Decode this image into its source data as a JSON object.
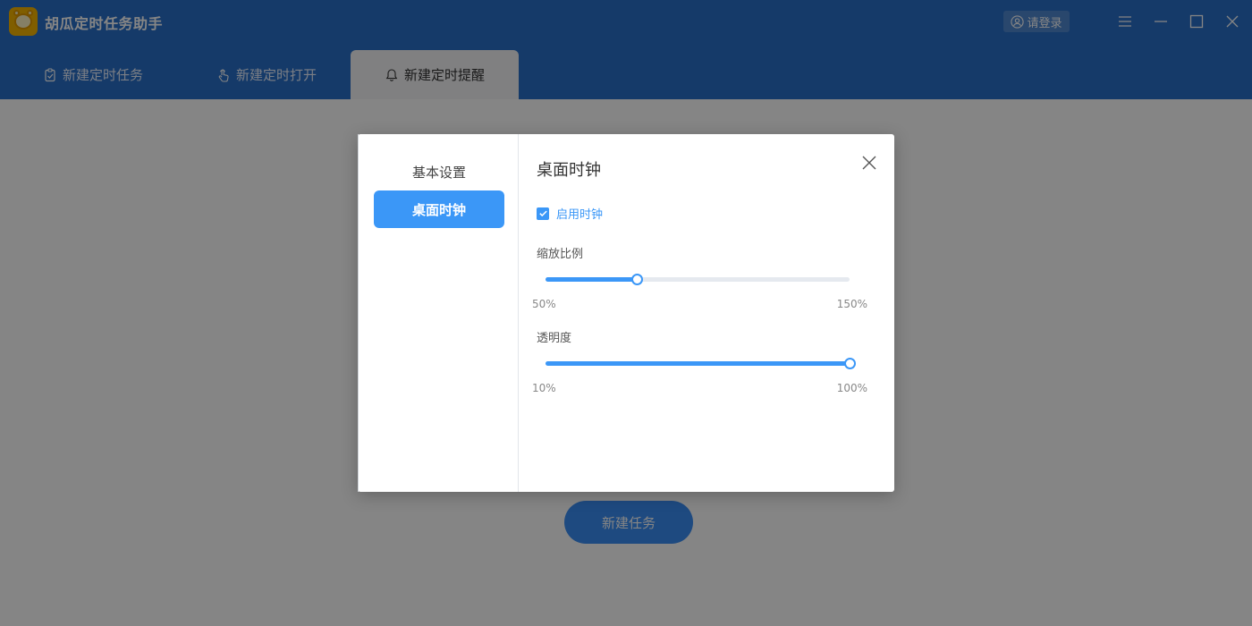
{
  "app": {
    "title": "胡瓜定时任务助手",
    "login_label": "请登录"
  },
  "tabs": [
    {
      "label": "新建定时任务",
      "icon": "clipboard-check-icon"
    },
    {
      "label": "新建定时打开",
      "icon": "hand-pointer-icon"
    },
    {
      "label": "新建定时提醒",
      "icon": "bell-icon"
    }
  ],
  "main": {
    "new_task_label": "新建任务"
  },
  "dialog": {
    "nav": [
      {
        "label": "基本设置"
      },
      {
        "label": "桌面时钟"
      }
    ],
    "title": "桌面时钟",
    "enable_clock": {
      "label": "启用时钟",
      "checked": true
    },
    "scale": {
      "label": "缩放比例",
      "min_label": "50%",
      "max_label": "150%",
      "value_fraction": 0.3
    },
    "opacity": {
      "label": "透明度",
      "min_label": "10%",
      "max_label": "100%",
      "value_fraction": 1.0
    }
  },
  "colors": {
    "header": "#2a6fc9",
    "accent": "#3b97f7",
    "logo": "#f5b400"
  }
}
